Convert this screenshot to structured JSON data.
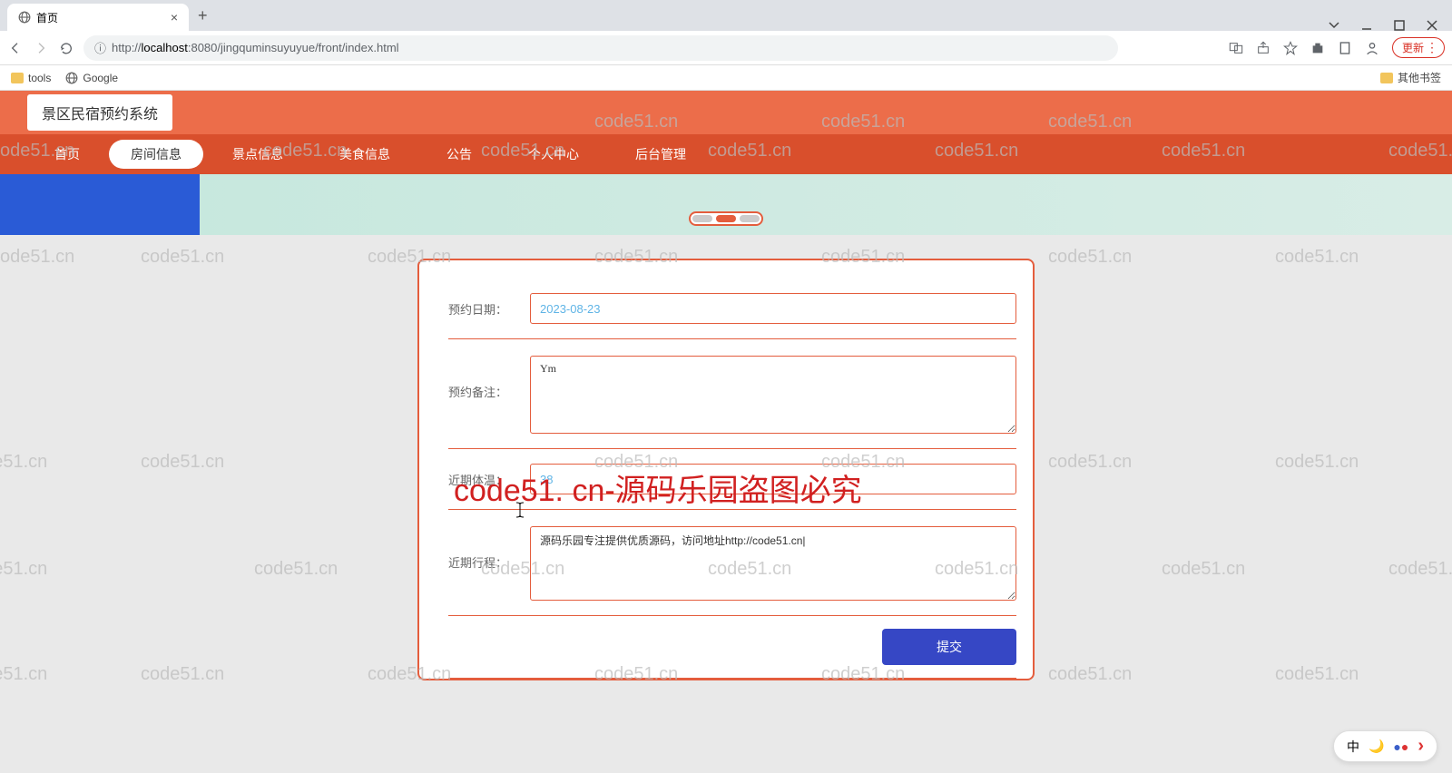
{
  "browser": {
    "tab_title": "首页",
    "url_prefix": "http://",
    "url_host": "localhost",
    "url_path": ":8080/jingquminsuyuyue/front/index.html",
    "bookmarks": {
      "tools": "tools",
      "google": "Google",
      "other": "其他书签"
    },
    "update_btn": "更新"
  },
  "site": {
    "title": "景区民宿预约系统"
  },
  "nav": [
    {
      "label": "首页",
      "active": false
    },
    {
      "label": "房间信息",
      "active": true
    },
    {
      "label": "景点信息",
      "active": false
    },
    {
      "label": "美食信息",
      "active": false
    },
    {
      "label": "公告",
      "active": false
    },
    {
      "label": "个人中心",
      "active": false
    },
    {
      "label": "后台管理",
      "active": false
    }
  ],
  "form": {
    "date_label": "预约日期：",
    "date_value": "2023-08-23",
    "note_label": "预约备注：",
    "note_value": "Ym",
    "temp_label": "近期体温：",
    "temp_value": "38",
    "trip_label": "近期行程：",
    "trip_value": "源码乐园专注提供优质源码，访问地址http://code51.cn",
    "submit": "提交"
  },
  "watermark_text": "code51.cn",
  "big_watermark": "code51. cn-源码乐园盗图必究",
  "ime": {
    "ch": "中"
  }
}
